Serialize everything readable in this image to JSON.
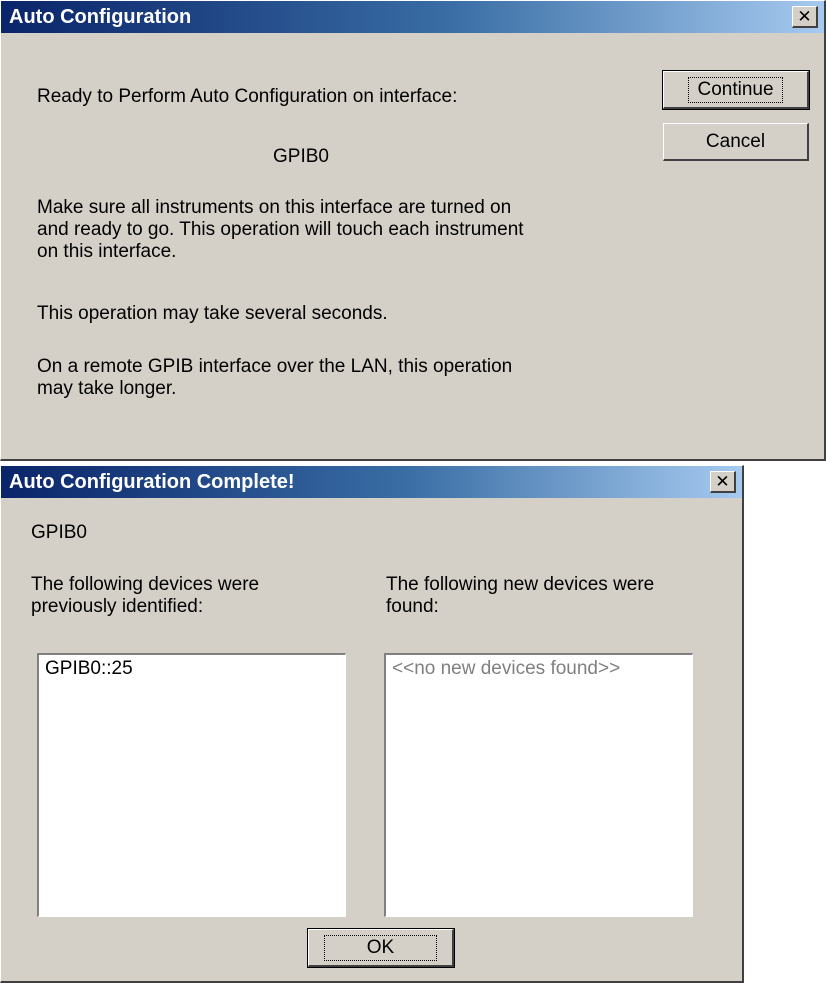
{
  "dialog1": {
    "title": "Auto Configuration",
    "close_label": "✕",
    "ready_text": "Ready to Perform Auto Configuration on interface:",
    "interface": "GPIB0",
    "instructions": "Make sure all instruments on this interface are turned on\nand ready to go. This operation will touch each instrument\non this interface.",
    "duration_note": "This operation may take several seconds.",
    "remote_note": "On a remote GPIB interface over the LAN, this operation\nmay take longer.",
    "continue_label": "Continue",
    "cancel_label": "Cancel"
  },
  "dialog2": {
    "title": "Auto Configuration Complete!",
    "close_label": "✕",
    "interface": "GPIB0",
    "previous_label": "The following devices were\npreviously identified:",
    "new_label": "The following new devices were\nfound:",
    "previous_devices": [
      "GPIB0::25"
    ],
    "new_devices_placeholder": "<<no new devices found>>",
    "ok_label": "OK"
  },
  "colors": {
    "dialog_face": "#d4d0c8",
    "title_start": "#0a246a",
    "title_end": "#a6caf0"
  }
}
